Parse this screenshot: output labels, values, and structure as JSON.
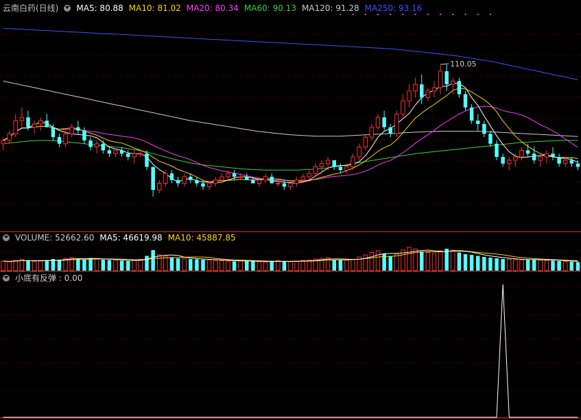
{
  "title": "云南白药(日线)",
  "ma_header": [
    {
      "label": "MA5: 80.88",
      "color": "#ffffff"
    },
    {
      "label": "MA10: 81.02",
      "color": "#ffd700"
    },
    {
      "label": "MA20: 80.34",
      "color": "#ff3cff"
    },
    {
      "label": "MA60: 90.13",
      "color": "#3cd23c"
    },
    {
      "label": "MA120: 91.28",
      "color": "#cccccc"
    },
    {
      "label": "MA250: 93.16",
      "color": "#3c50ff"
    }
  ],
  "vol_header": [
    {
      "label": "VOLUME: 52662.60",
      "color": "#cccccc"
    },
    {
      "label": "MA5: 46619.98",
      "color": "#ffffff"
    },
    {
      "label": "MA10: 45887.85",
      "color": "#ffd700"
    }
  ],
  "ind_header": [
    {
      "label": "小底有反弹 : 0.00",
      "color": "#cccccc"
    }
  ],
  "peak_label": "110.05",
  "colors": {
    "up": "#ff3232",
    "down": "#54ffff",
    "grid": "#8b0000",
    "axis": "#ff3232"
  },
  "chart_data": {
    "type": "candlestick",
    "series_names": [
      "MA5",
      "MA10",
      "MA20",
      "MA60",
      "MA120",
      "MA250",
      "VOLUME",
      "小底有反弹"
    ],
    "peak_high": 110.05,
    "candles": [
      [
        86,
        88,
        84,
        87
      ],
      [
        87,
        90,
        86,
        89
      ],
      [
        89,
        95,
        88,
        93
      ],
      [
        93,
        97,
        91,
        94
      ],
      [
        94,
        96,
        90,
        91
      ],
      [
        91,
        93,
        89,
        92
      ],
      [
        92,
        94,
        90,
        93
      ],
      [
        93,
        95,
        91,
        91
      ],
      [
        91,
        92,
        87,
        88
      ],
      [
        88,
        89,
        85,
        86
      ],
      [
        86,
        90,
        85,
        89
      ],
      [
        89,
        92,
        88,
        91
      ],
      [
        91,
        93,
        89,
        90
      ],
      [
        90,
        91,
        86,
        87
      ],
      [
        87,
        88,
        84,
        85
      ],
      [
        85,
        87,
        83,
        86
      ],
      [
        86,
        87,
        83,
        84
      ],
      [
        84,
        85,
        82,
        83
      ],
      [
        83,
        84,
        82,
        84
      ],
      [
        84,
        85,
        82,
        83
      ],
      [
        83,
        84,
        81,
        82
      ],
      [
        82,
        84,
        80,
        83
      ],
      [
        83,
        84,
        82,
        83
      ],
      [
        83,
        84,
        78,
        79
      ],
      [
        79,
        79,
        70,
        72
      ],
      [
        72,
        75,
        71,
        74
      ],
      [
        74,
        78,
        73,
        77
      ],
      [
        77,
        78,
        74,
        75
      ],
      [
        75,
        76,
        73,
        74
      ],
      [
        74,
        77,
        73,
        76
      ],
      [
        76,
        77,
        74,
        75
      ],
      [
        75,
        76,
        73,
        74
      ],
      [
        74,
        75,
        72,
        73
      ],
      [
        73,
        75,
        72,
        74
      ],
      [
        74,
        76,
        73,
        75
      ],
      [
        75,
        77,
        74,
        76
      ],
      [
        76,
        78,
        75,
        77
      ],
      [
        77,
        78,
        75,
        76
      ],
      [
        76,
        77,
        75,
        76
      ],
      [
        76,
        77,
        75,
        75
      ],
      [
        75,
        76,
        74,
        74
      ],
      [
        74,
        76,
        73,
        75
      ],
      [
        75,
        77,
        74,
        76
      ],
      [
        76,
        77,
        74,
        74
      ],
      [
        74,
        75,
        73,
        74
      ],
      [
        74,
        75,
        72,
        73
      ],
      [
        73,
        74,
        72,
        74
      ],
      [
        74,
        76,
        73,
        75
      ],
      [
        75,
        77,
        74,
        76
      ],
      [
        76,
        78,
        75,
        77
      ],
      [
        77,
        80,
        76,
        79
      ],
      [
        79,
        81,
        77,
        80
      ],
      [
        80,
        82,
        78,
        81
      ],
      [
        81,
        81,
        78,
        79
      ],
      [
        79,
        80,
        77,
        78
      ],
      [
        78,
        80,
        77,
        79
      ],
      [
        79,
        83,
        78,
        82
      ],
      [
        82,
        86,
        81,
        85
      ],
      [
        85,
        89,
        84,
        88
      ],
      [
        88,
        92,
        87,
        91
      ],
      [
        91,
        95,
        90,
        94
      ],
      [
        94,
        96,
        90,
        91
      ],
      [
        91,
        92,
        88,
        89
      ],
      [
        89,
        96,
        88,
        95
      ],
      [
        95,
        101,
        94,
        99
      ],
      [
        99,
        104,
        97,
        102
      ],
      [
        102,
        106,
        100,
        104
      ],
      [
        104,
        107,
        98,
        100
      ],
      [
        100,
        103,
        99,
        102
      ],
      [
        102,
        105,
        100,
        103
      ],
      [
        103,
        110,
        101,
        108
      ],
      [
        108,
        110,
        102,
        104
      ],
      [
        104,
        106,
        101,
        105
      ],
      [
        105,
        106,
        100,
        101
      ],
      [
        101,
        102,
        96,
        97
      ],
      [
        97,
        98,
        92,
        93
      ],
      [
        93,
        95,
        90,
        92
      ],
      [
        92,
        93,
        88,
        89
      ],
      [
        89,
        90,
        85,
        86
      ],
      [
        86,
        87,
        81,
        82
      ],
      [
        82,
        83,
        79,
        80
      ],
      [
        80,
        82,
        78,
        81
      ],
      [
        81,
        83,
        79,
        82
      ],
      [
        82,
        85,
        81,
        84
      ],
      [
        84,
        86,
        82,
        83
      ],
      [
        83,
        85,
        80,
        81
      ],
      [
        81,
        83,
        79,
        82
      ],
      [
        82,
        84,
        80,
        83
      ],
      [
        83,
        85,
        81,
        82
      ],
      [
        82,
        83,
        79,
        80
      ],
      [
        80,
        82,
        79,
        81
      ],
      [
        81,
        82,
        79,
        80
      ],
      [
        80,
        81,
        78,
        79
      ]
    ],
    "volumes": [
      30,
      28,
      32,
      35,
      31,
      29,
      30,
      33,
      36,
      34,
      38,
      40,
      37,
      35,
      39,
      36,
      34,
      33,
      32,
      31,
      30,
      33,
      35,
      45,
      62,
      48,
      44,
      40,
      38,
      37,
      36,
      35,
      34,
      33,
      32,
      31,
      30,
      29,
      31,
      30,
      29,
      28,
      27,
      30,
      31,
      29,
      28,
      30,
      32,
      33,
      36,
      38,
      40,
      34,
      33,
      32,
      35,
      42,
      48,
      55,
      60,
      52,
      45,
      50,
      62,
      70,
      65,
      58,
      55,
      52,
      60,
      66,
      62,
      55,
      50,
      48,
      45,
      42,
      40,
      38,
      36,
      35,
      34,
      33,
      34,
      35,
      33,
      32,
      31,
      30,
      29,
      28,
      27
    ],
    "signal": [
      0,
      0,
      0,
      0,
      0,
      0,
      0,
      0,
      0,
      0,
      0,
      0,
      0,
      0,
      0,
      0,
      0,
      0,
      0,
      0,
      0,
      0,
      0,
      0,
      0,
      0,
      0,
      0,
      0,
      0,
      0,
      0,
      0,
      0,
      0,
      0,
      0,
      0,
      0,
      0,
      0,
      0,
      0,
      0,
      0,
      0,
      0,
      0,
      0,
      0,
      0,
      0,
      0,
      0,
      0,
      0,
      0,
      0,
      0,
      0,
      0,
      0,
      0,
      0,
      0,
      0,
      0,
      0,
      0,
      0,
      0,
      0,
      0,
      0,
      0,
      0,
      0,
      0,
      0,
      0,
      1,
      0,
      0,
      0,
      0,
      0,
      0,
      0,
      0,
      0,
      0,
      0,
      0
    ],
    "ma60": [
      86,
      86.2,
      86.4,
      86.6,
      86.8,
      86.9,
      87,
      87,
      86.9,
      86.8,
      86.6,
      86.4,
      86.2,
      86,
      85.8,
      85.6,
      85.4,
      85.2,
      85,
      84.8,
      84.5,
      84.2,
      83.9,
      83.5,
      83,
      82.5,
      82,
      81.5,
      81,
      80.6,
      80.2,
      79.9,
      79.6,
      79.4,
      79.2,
      79,
      78.8,
      78.6,
      78.4,
      78.3,
      78.2,
      78.1,
      78,
      78,
      78,
      78,
      78,
      78,
      78.1,
      78.2,
      78.3,
      78.5,
      78.7,
      79,
      79.3,
      79.6,
      80,
      80.3,
      80.6,
      80.9,
      81.2,
      81.5,
      81.8,
      82.1,
      82.4,
      82.7,
      83,
      83.2,
      83.4,
      83.6,
      83.8,
      84,
      84.2,
      84.4,
      84.6,
      84.8,
      85,
      85.2,
      85.4,
      85.6,
      85.8,
      86,
      86.2,
      86.4,
      86.5,
      86.6,
      86.7,
      86.8,
      86.9,
      87,
      87,
      87,
      87
    ],
    "ma120": [
      105,
      104.6,
      104.2,
      103.8,
      103.4,
      103,
      102.6,
      102.2,
      101.8,
      101.4,
      101,
      100.6,
      100.2,
      99.8,
      99.4,
      99,
      98.6,
      98.2,
      97.8,
      97.4,
      97,
      96.6,
      96.2,
      95.8,
      95.4,
      95,
      94.6,
      94.2,
      93.8,
      93.4,
      93,
      92.7,
      92.4,
      92.1,
      91.8,
      91.5,
      91.2,
      90.9,
      90.6,
      90.3,
      90,
      89.7,
      89.5,
      89.3,
      89.1,
      88.9,
      88.7,
      88.6,
      88.5,
      88.4,
      88.3,
      88.3,
      88.3,
      88.3,
      88.3,
      88.4,
      88.5,
      88.6,
      88.7,
      88.8,
      88.9,
      89,
      89.1,
      89.2,
      89.3,
      89.4,
      89.5,
      89.6,
      89.7,
      89.7,
      89.8,
      89.8,
      89.8,
      89.8,
      89.8,
      89.8,
      89.8,
      89.7,
      89.6,
      89.5,
      89.4,
      89.3,
      89.2,
      89.1,
      89,
      88.9,
      88.8,
      88.7,
      88.6,
      88.5,
      88.4,
      88.3,
      88.2
    ],
    "ma250": [
      121,
      120.9,
      120.8,
      120.7,
      120.6,
      120.5,
      120.4,
      120.3,
      120.2,
      120.1,
      120,
      119.9,
      119.8,
      119.7,
      119.6,
      119.5,
      119.4,
      119.3,
      119.2,
      119.1,
      119,
      118.9,
      118.8,
      118.7,
      118.6,
      118.5,
      118.4,
      118.3,
      118.2,
      118.1,
      118,
      117.9,
      117.8,
      117.7,
      117.6,
      117.5,
      117.4,
      117.3,
      117.2,
      117.1,
      117,
      116.9,
      116.8,
      116.7,
      116.6,
      116.5,
      116.4,
      116.3,
      116.2,
      116.1,
      116,
      115.9,
      115.8,
      115.7,
      115.6,
      115.5,
      115.4,
      115.3,
      115.2,
      115.1,
      115,
      114.9,
      114.8,
      114.6,
      114.4,
      114.2,
      114,
      113.8,
      113.6,
      113.4,
      113.2,
      113,
      112.8,
      112.5,
      112.2,
      111.9,
      111.6,
      111.3,
      111,
      110.6,
      110.2,
      109.8,
      109.4,
      109,
      108.6,
      108.2,
      107.8,
      107.4,
      107,
      106.6,
      106.2,
      105.8,
      105.4
    ]
  }
}
